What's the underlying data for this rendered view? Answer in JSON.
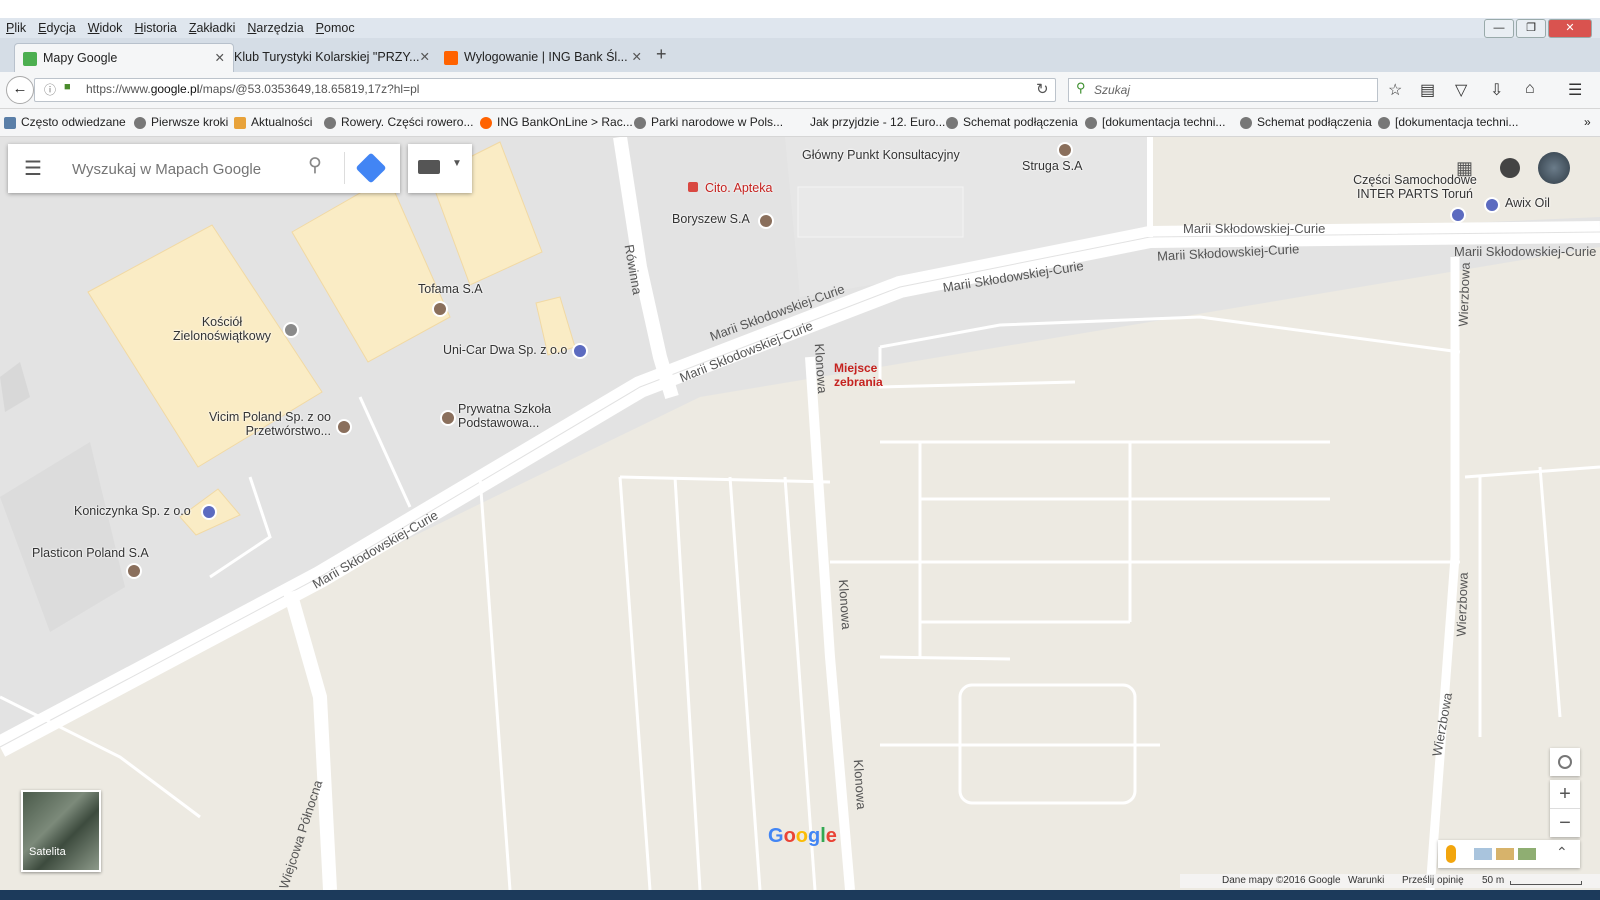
{
  "menubar": {
    "items": [
      "Plik",
      "Edycja",
      "Widok",
      "Historia",
      "Zakładki",
      "Narzędzia",
      "Pomoc"
    ]
  },
  "tabs": [
    {
      "label": "Mapy Google",
      "active": true
    },
    {
      "label": "Klub Turystyki Kolarskiej \"PRZY...",
      "active": false
    },
    {
      "label": "Wylogowanie | ING Bank Śl...",
      "active": false
    }
  ],
  "new_tab_label": "+",
  "address": {
    "prefix": "https://www.",
    "domain": "google.pl",
    "path": "/maps/@53.0353649,18.65819,17z?hl=pl"
  },
  "search_placeholder": "Szukaj",
  "bookmarks": [
    "Często odwiedzane",
    "Pierwsze kroki",
    "Aktualności",
    "Rowery. Części rowero...",
    "ING BankOnLine > Rac...",
    "Parki narodowe w Pols...",
    "Jak przyjdzie - 12. Euro...",
    "Schemat podłączenia",
    "[dokumentacja techni...",
    "Schemat podłączenia",
    "[dokumentacja techni..."
  ],
  "map": {
    "search_placeholder": "Wyszukaj w Mapach Google",
    "satellite_label": "Satelita",
    "places": [
      "Główny Punkt Konsultacyjny",
      "Struga S.A",
      "Cito. Apteka",
      "Boryszew S.A",
      "Tofama S.A",
      "Kościół Zielonoświątkowy",
      "Uni-Car Dwa Sp. z o.o",
      "Prywatna Szkoła Podstawowa...",
      "Vicim Poland Sp. z oo Przetwórstwo...",
      "Koniczynka Sp. z o.o",
      "Plasticon Poland S.A",
      "Części Samochodowe INTER PARTS Toruń",
      "Awix Oil"
    ],
    "roads": [
      "Marii Skłodowskiej-Curie",
      "Rówinna",
      "Klonowa",
      "Wierzbowa",
      "Wiejcowa Północna"
    ],
    "highlight": "Miejsce zebrania",
    "logo": "Google",
    "footer": {
      "data": "Dane mapy ©2016 Google",
      "terms": "Warunki",
      "feedback": "Prześlij opinię",
      "scale": "50 m"
    }
  },
  "colors": {
    "map_bg": "#edeae2",
    "block": "#faecc5",
    "road": "#ffffff",
    "highlight": "#c5221f",
    "chrome": "#d5dde6"
  }
}
